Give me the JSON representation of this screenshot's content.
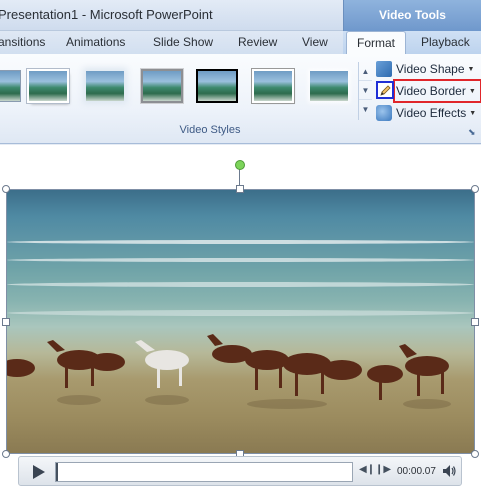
{
  "window": {
    "title": "Presentation1 - Microsoft PowerPoint",
    "contextual_tab_group": "Video Tools"
  },
  "tabs": [
    {
      "label": "ansitions"
    },
    {
      "label": "Animations"
    },
    {
      "label": "Slide Show"
    },
    {
      "label": "Review"
    },
    {
      "label": "View"
    },
    {
      "label": "Format",
      "active": true
    },
    {
      "label": "Playback"
    }
  ],
  "ribbon": {
    "group_label": "Video Styles",
    "commands": {
      "video_shape": "Video Shape",
      "video_border": "Video Border",
      "video_effects": "Video Effects"
    },
    "highlight_colors": {
      "border_command": "#e0262b",
      "pen_icon": "#1f2fd6"
    }
  },
  "player": {
    "time": "00:00.07"
  },
  "icons": [
    "play-icon",
    "step-back-icon",
    "step-forward-icon",
    "volume-icon",
    "video-shape-icon",
    "video-border-pen-icon",
    "video-effects-icon"
  ]
}
